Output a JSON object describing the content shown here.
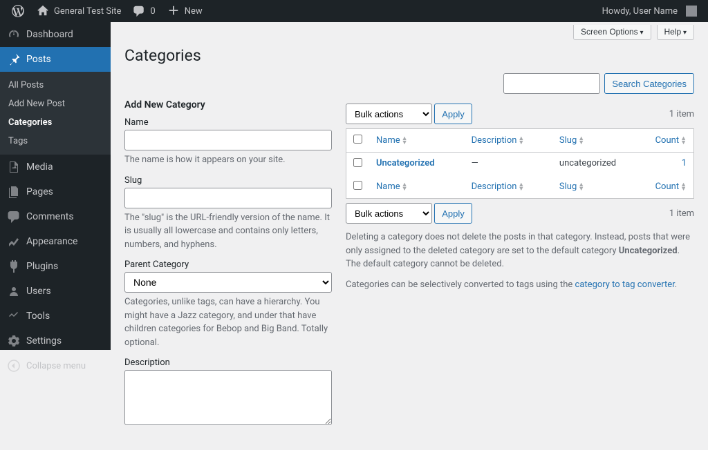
{
  "adminbar": {
    "site_name": "General Test Site",
    "comments_count": "0",
    "new_label": "New",
    "howdy": "Howdy, User Name"
  },
  "sidebar": {
    "items": [
      {
        "label": "Dashboard",
        "icon": "dashboard-icon"
      },
      {
        "label": "Posts",
        "icon": "pin-icon"
      },
      {
        "label": "Media",
        "icon": "media-icon"
      },
      {
        "label": "Pages",
        "icon": "pages-icon"
      },
      {
        "label": "Comments",
        "icon": "comments-icon"
      },
      {
        "label": "Appearance",
        "icon": "appearance-icon"
      },
      {
        "label": "Plugins",
        "icon": "plugins-icon"
      },
      {
        "label": "Users",
        "icon": "users-icon"
      },
      {
        "label": "Tools",
        "icon": "tools-icon"
      },
      {
        "label": "Settings",
        "icon": "settings-icon"
      }
    ],
    "submenu_posts": [
      "All Posts",
      "Add New Post",
      "Categories",
      "Tags"
    ],
    "collapse_label": "Collapse menu"
  },
  "screen": {
    "options_label": "Screen Options",
    "help_label": "Help",
    "page_title": "Categories",
    "search_button": "Search Categories"
  },
  "form": {
    "heading": "Add New Category",
    "name_label": "Name",
    "name_help": "The name is how it appears on your site.",
    "slug_label": "Slug",
    "slug_help": "The \"slug\" is the URL-friendly version of the name. It is usually all lowercase and contains only letters, numbers, and hyphens.",
    "parent_label": "Parent Category",
    "parent_selected": "None",
    "parent_help": "Categories, unlike tags, can have a hierarchy. You might have a Jazz category, and under that have children categories for Bebop and Big Band. Totally optional.",
    "desc_label": "Description"
  },
  "table": {
    "bulk_label": "Bulk actions",
    "apply_label": "Apply",
    "items_count": "1 item",
    "columns": {
      "name": "Name",
      "description": "Description",
      "slug": "Slug",
      "count": "Count"
    },
    "rows": [
      {
        "name": "Uncategorized",
        "description": "—",
        "slug": "uncategorized",
        "count": "1"
      }
    ]
  },
  "notes": {
    "p1_a": "Deleting a category does not delete the posts in that category. Instead, posts that were only assigned to the deleted category are set to the default category ",
    "p1_b": "Uncategorized",
    "p1_c": ". The default category cannot be deleted.",
    "p2_a": "Categories can be selectively converted to tags using the ",
    "p2_link": "category to tag converter",
    "p2_b": "."
  }
}
